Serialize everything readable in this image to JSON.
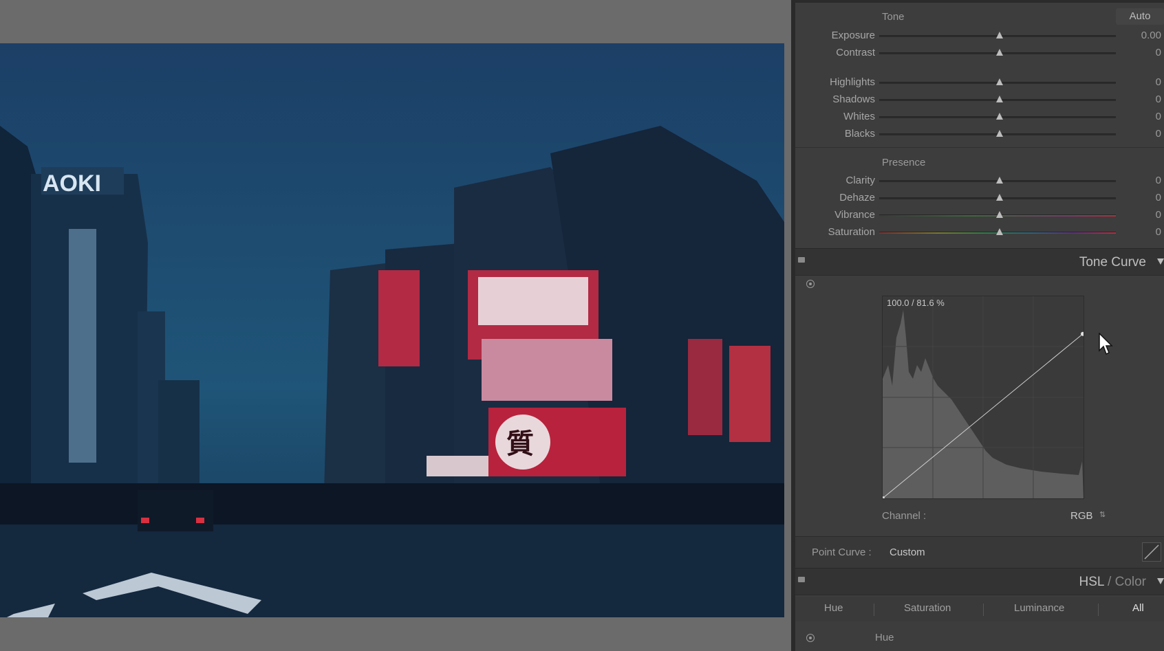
{
  "tone": {
    "section_label": "Tone",
    "auto_label": "Auto",
    "sliders": [
      {
        "label": "Exposure",
        "value": "0.00"
      },
      {
        "label": "Contrast",
        "value": "0"
      },
      {
        "label": "Highlights",
        "value": "0"
      },
      {
        "label": "Shadows",
        "value": "0"
      },
      {
        "label": "Whites",
        "value": "0"
      },
      {
        "label": "Blacks",
        "value": "0"
      }
    ]
  },
  "presence": {
    "section_label": "Presence",
    "sliders": [
      {
        "label": "Clarity",
        "value": "0"
      },
      {
        "label": "Dehaze",
        "value": "0"
      },
      {
        "label": "Vibrance",
        "value": "0"
      },
      {
        "label": "Saturation",
        "value": "0"
      }
    ]
  },
  "tone_curve": {
    "title": "Tone Curve",
    "readout": "100.0 / 81.6 %",
    "channel_label": "Channel :",
    "channel_value": "RGB",
    "point_curve_label": "Point Curve :",
    "point_curve_value": "Custom",
    "curve_point": {
      "input": 100.0,
      "output": 81.6
    }
  },
  "hsl": {
    "title_main": "HSL",
    "title_sep": " / ",
    "title_secondary": "Color",
    "tabs": [
      "Hue",
      "Saturation",
      "Luminance",
      "All"
    ],
    "active_tab": "All",
    "sub_label": "Hue"
  },
  "icons": {
    "target": "target-adjustment-icon",
    "cursor": "mouse-pointer-icon",
    "disclosure": "triangle-down-icon"
  }
}
